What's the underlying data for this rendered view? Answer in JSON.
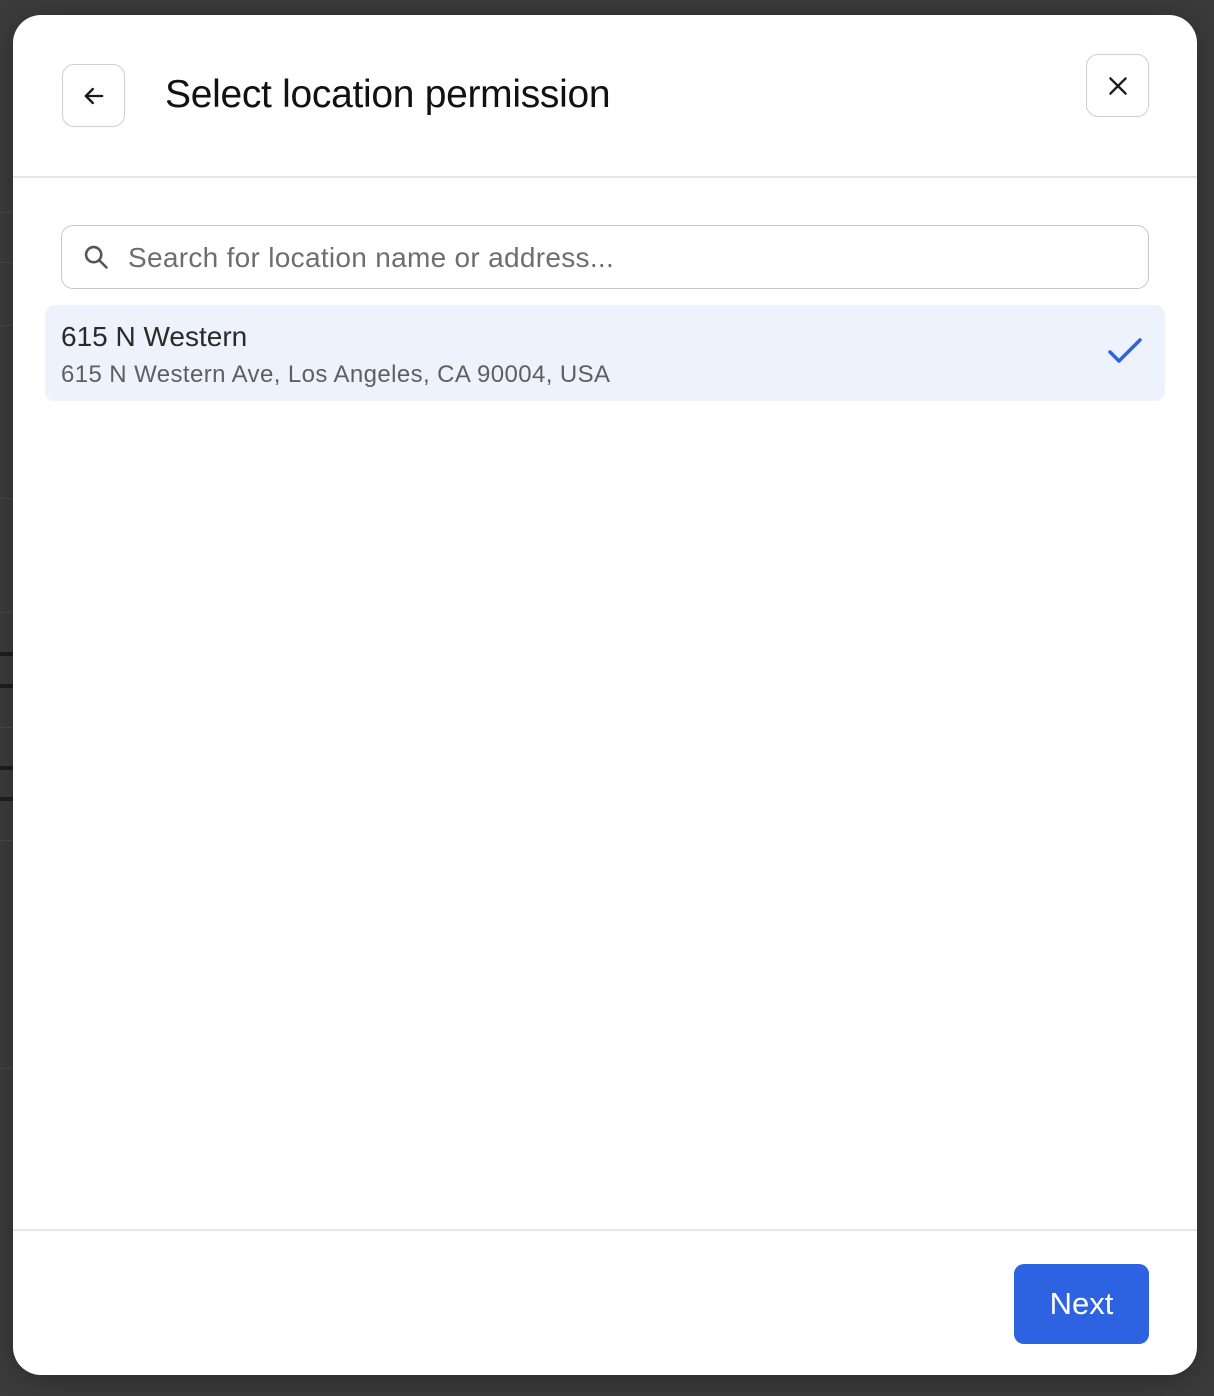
{
  "modal": {
    "title": "Select location permission",
    "back_icon": "arrow-left-icon",
    "close_icon": "close-icon"
  },
  "search": {
    "placeholder": "Search for location name or address...",
    "value": "",
    "icon": "search-icon"
  },
  "locations": [
    {
      "name": "615 N Western",
      "address": "615 N Western Ave, Los Angeles, CA 90004, USA",
      "selected": true,
      "selected_icon": "checkmark-icon"
    }
  ],
  "footer": {
    "next_label": "Next"
  },
  "colors": {
    "accent": "#2d62e0",
    "selected_row": "#edf2fc",
    "backdrop": "#3a3a3a"
  }
}
